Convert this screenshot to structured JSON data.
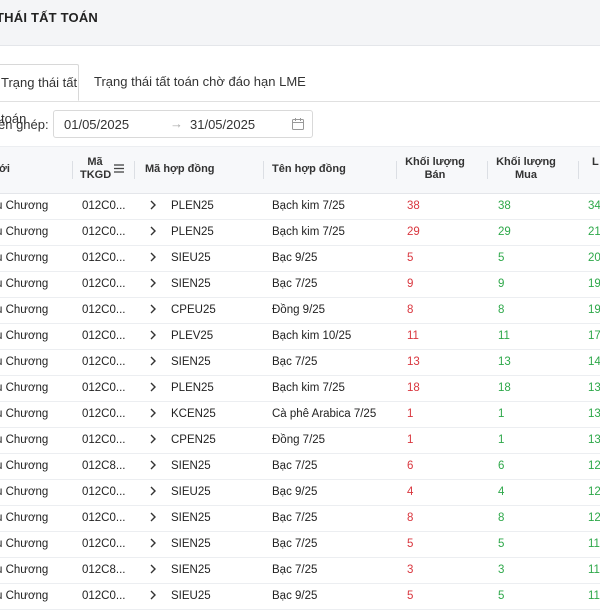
{
  "page": {
    "title": "THÁI TẤT TOÁN"
  },
  "tabs": [
    {
      "label": "Trạng thái tất toán",
      "active": true
    },
    {
      "label": "Trạng thái tất toán chờ đáo hạn LME",
      "active": false
    }
  ],
  "filter": {
    "label": "ên ghép:",
    "date_from": "01/05/2025",
    "arrow": "→",
    "date_to": "31/05/2025"
  },
  "table": {
    "columns": {
      "name": "iới",
      "tkgd_line1": "Mã",
      "tkgd_line2": "TKGD",
      "ma": "Mã hợp đồng",
      "ten": "Tên hợp đồng",
      "ban_line1": "Khối lượng",
      "ban_line2": "Bán",
      "mua_line1": "Khối lượng",
      "mua_line2": "Mua",
      "l": "L"
    },
    "rows": [
      {
        "name": "u Chương",
        "tkgd": "012C0...",
        "ma": "PLEN25",
        "ten": "Bạch kim 7/25",
        "ban": "38",
        "mua": "38",
        "l": "34"
      },
      {
        "name": "u Chương",
        "tkgd": "012C0...",
        "ma": "PLEN25",
        "ten": "Bạch kim 7/25",
        "ban": "29",
        "mua": "29",
        "l": "21"
      },
      {
        "name": "u Chương",
        "tkgd": "012C0...",
        "ma": "SIEU25",
        "ten": "Bạc 9/25",
        "ban": "5",
        "mua": "5",
        "l": "20"
      },
      {
        "name": "u Chương",
        "tkgd": "012C0...",
        "ma": "SIEN25",
        "ten": "Bạc 7/25",
        "ban": "9",
        "mua": "9",
        "l": "19"
      },
      {
        "name": "u Chương",
        "tkgd": "012C0...",
        "ma": "CPEU25",
        "ten": "Đồng 9/25",
        "ban": "8",
        "mua": "8",
        "l": "19"
      },
      {
        "name": "u Chương",
        "tkgd": "012C0...",
        "ma": "PLEV25",
        "ten": "Bạch kim 10/25",
        "ban": "11",
        "mua": "11",
        "l": "17"
      },
      {
        "name": "u Chương",
        "tkgd": "012C0...",
        "ma": "SIEN25",
        "ten": "Bạc 7/25",
        "ban": "13",
        "mua": "13",
        "l": "14"
      },
      {
        "name": "u Chương",
        "tkgd": "012C0...",
        "ma": "PLEN25",
        "ten": "Bạch kim 7/25",
        "ban": "18",
        "mua": "18",
        "l": "13"
      },
      {
        "name": "u Chương",
        "tkgd": "012C0...",
        "ma": "KCEN25",
        "ten": "Cà phê Arabica 7/25",
        "ban": "1",
        "mua": "1",
        "l": "13"
      },
      {
        "name": "u Chương",
        "tkgd": "012C0...",
        "ma": "CPEN25",
        "ten": "Đồng 7/25",
        "ban": "1",
        "mua": "1",
        "l": "13"
      },
      {
        "name": "u Chương",
        "tkgd": "012C8...",
        "ma": "SIEN25",
        "ten": "Bạc 7/25",
        "ban": "6",
        "mua": "6",
        "l": "12"
      },
      {
        "name": "u Chương",
        "tkgd": "012C0...",
        "ma": "SIEU25",
        "ten": "Bạc 9/25",
        "ban": "4",
        "mua": "4",
        "l": "12"
      },
      {
        "name": "u Chương",
        "tkgd": "012C0...",
        "ma": "SIEN25",
        "ten": "Bạc 7/25",
        "ban": "8",
        "mua": "8",
        "l": "12"
      },
      {
        "name": "u Chương",
        "tkgd": "012C0...",
        "ma": "SIEN25",
        "ten": "Bạc 7/25",
        "ban": "5",
        "mua": "5",
        "l": "11"
      },
      {
        "name": "u Chương",
        "tkgd": "012C8...",
        "ma": "SIEN25",
        "ten": "Bạc 7/25",
        "ban": "3",
        "mua": "3",
        "l": "11"
      },
      {
        "name": "u Chương",
        "tkgd": "012C0...",
        "ma": "SIEU25",
        "ten": "Bạc 9/25",
        "ban": "5",
        "mua": "5",
        "l": "11"
      }
    ]
  },
  "icons": {
    "sort": "menu-icon",
    "calendar": "calendar-icon",
    "expand": "chevron-right-icon"
  },
  "colors": {
    "sell": "#d9363e",
    "buy": "#2ea84a",
    "header_bg": "#f7f8fa",
    "topbar_bg": "#f4f5f7"
  }
}
